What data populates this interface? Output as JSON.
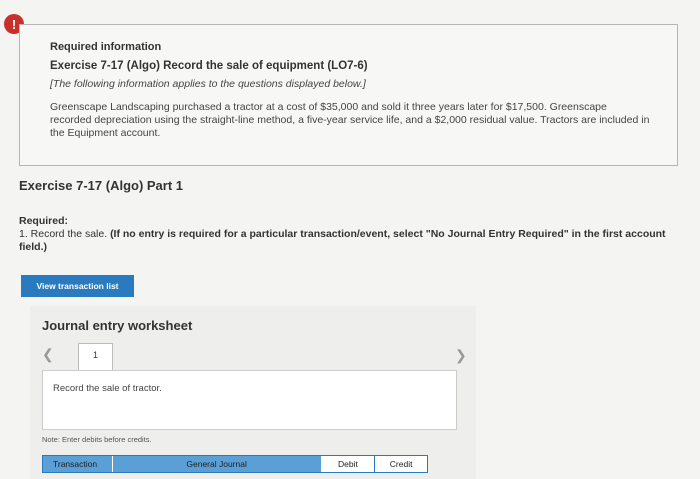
{
  "alert": {
    "icon": "exclamation-icon",
    "glyph": "!",
    "color": "#c9302c"
  },
  "info": {
    "heading": "Required information",
    "exercise_title": "Exercise 7-17 (Algo) Record the sale of equipment (LO7-6)",
    "note": "[The following information applies to the questions displayed below.]",
    "description": "Greenscape Landscaping purchased a tractor at a cost of $35,000 and sold it three years later for $17,500. Greenscape recorded depreciation using the straight-line method, a five-year service life, and a $2,000 residual value. Tractors are included in the Equipment account."
  },
  "part": {
    "title": "Exercise 7-17 (Algo) Part 1"
  },
  "required": {
    "label": "Required:",
    "item": "1. Record the sale.",
    "instruction": "(If no entry is required for a particular transaction/event, select \"No Journal Entry Required\" in the first account field.)"
  },
  "buttons": {
    "view_transaction_list": "View transaction list"
  },
  "worksheet": {
    "title": "Journal entry worksheet",
    "tab_number": "1",
    "prompt": "Record the sale of tractor.",
    "note": "Note: Enter debits before credits.",
    "columns": [
      "Transaction",
      "General Journal",
      "Debit",
      "Credit"
    ]
  },
  "colors": {
    "primary": "#2a7ac0",
    "header_blue": "#5a9fd6"
  }
}
